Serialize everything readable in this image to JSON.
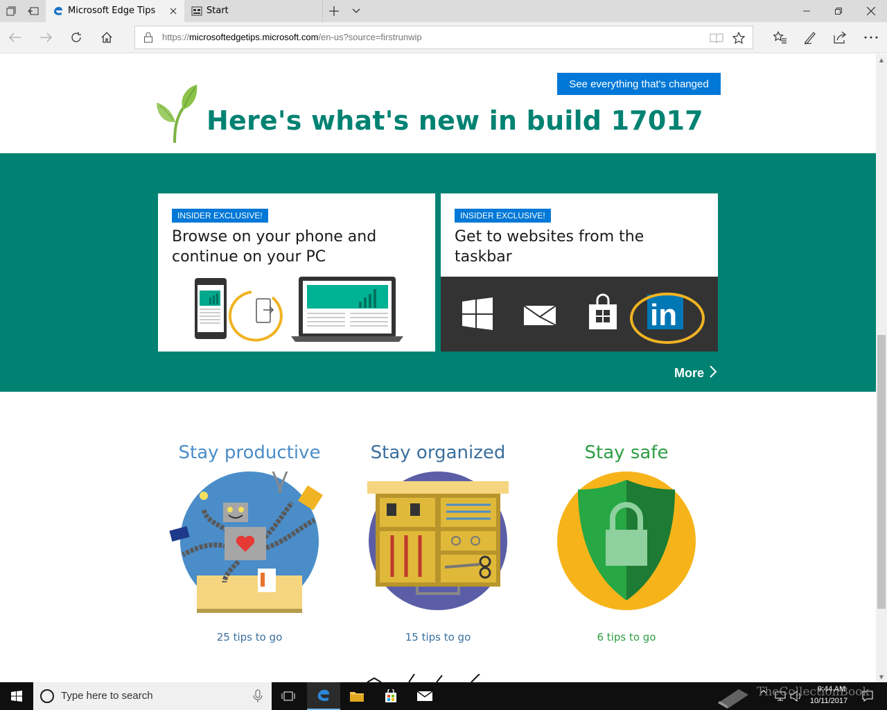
{
  "browser": {
    "tabs": [
      {
        "label": "Microsoft Edge Tips",
        "active": true,
        "icon": "edge-logo-icon"
      },
      {
        "label": "Start",
        "active": false,
        "icon": "start-page-icon"
      }
    ],
    "address": {
      "scheme": "https://",
      "host": "microsoftedgetips.microsoft.com",
      "path": "/en-us?source=firstrunwip"
    }
  },
  "page": {
    "changed_button": "See everything that's changed",
    "headline": "Here's what's new in build 17017",
    "cards": [
      {
        "badge": "INSIDER EXCLUSIVE!",
        "title": "Browse on your phone and continue on your PC"
      },
      {
        "badge": "INSIDER EXCLUSIVE!",
        "title": "Get to websites from the taskbar"
      }
    ],
    "more_link": "More",
    "categories": [
      {
        "title": "Stay productive",
        "tips": "25 tips to go",
        "color": "#4a8dc9"
      },
      {
        "title": "Stay organized",
        "tips": "15 tips to go",
        "color": "#3a6f9e"
      },
      {
        "title": "Stay safe",
        "tips": "6 tips to go",
        "color": "#2e9e44"
      }
    ]
  },
  "colors": {
    "brand_green": "#008272",
    "accent_blue": "#0078d7",
    "highlight_orange": "#f0b323"
  },
  "taskbar": {
    "search_placeholder": "Type here to search",
    "time": "9:44 AM",
    "date": "10/11/2017",
    "watermark": "TheCollectionBook"
  }
}
